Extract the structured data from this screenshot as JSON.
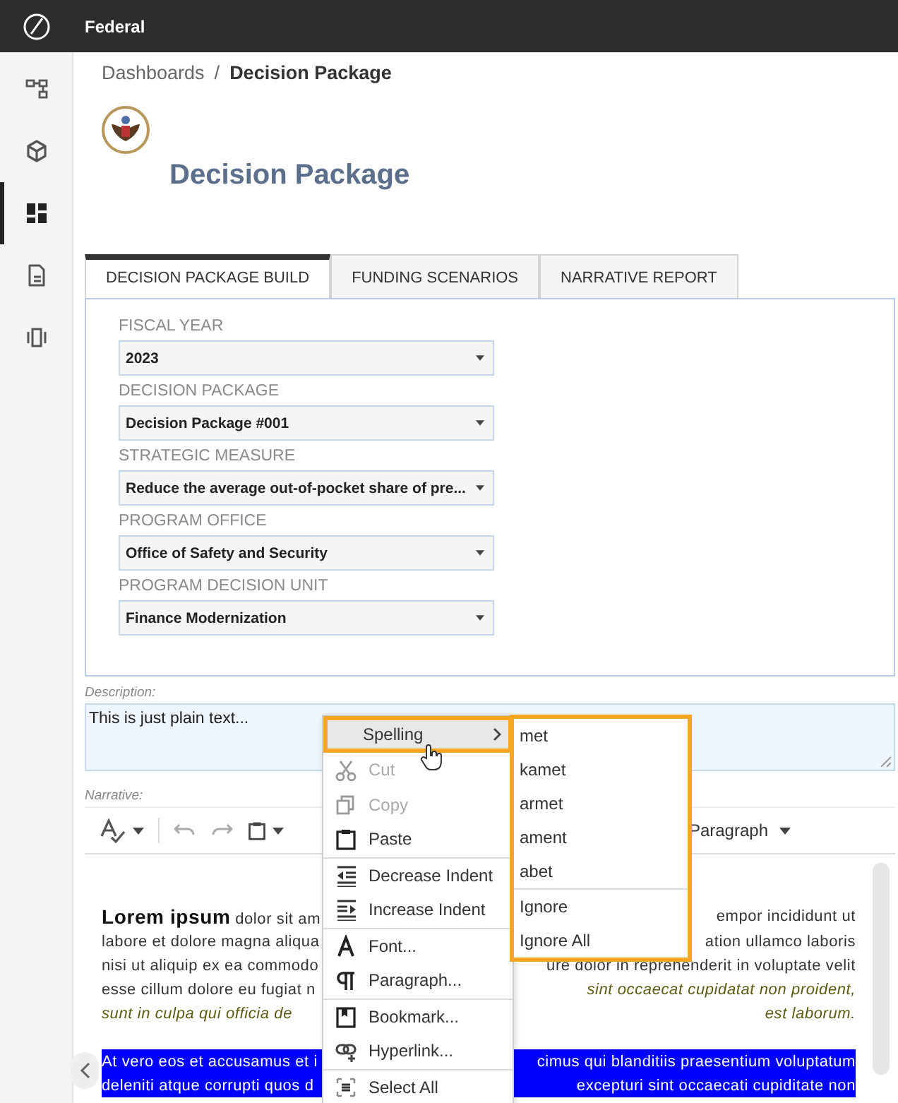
{
  "app_bar": {
    "title": "Federal"
  },
  "sidebar": {
    "items": [
      {
        "selected": false
      },
      {
        "selected": false
      },
      {
        "selected": true
      },
      {
        "selected": false
      },
      {
        "selected": false
      }
    ]
  },
  "breadcrumb": {
    "parent": "Dashboards",
    "separator": "/",
    "current": "Decision Package"
  },
  "page_title": "Decision Package",
  "tabs": [
    {
      "label": "DECISION PACKAGE BUILD",
      "selected": true
    },
    {
      "label": "FUNDING SCENARIOS",
      "selected": false
    },
    {
      "label": "NARRATIVE REPORT",
      "selected": false
    }
  ],
  "fields": [
    {
      "label": "FISCAL YEAR",
      "value": "2023"
    },
    {
      "label": "DECISION PACKAGE",
      "value": "Decision Package #001"
    },
    {
      "label": "STRATEGIC MEASURE",
      "value": "Reduce the average out-of-pocket share of pre..."
    },
    {
      "label": "PROGRAM OFFICE",
      "value": "Office of Safety and Security"
    },
    {
      "label": "PROGRAM DECISION UNIT",
      "value": "Finance Modernization"
    }
  ],
  "description": {
    "label": "Description:",
    "value": "This is just plain text..."
  },
  "narrative": {
    "label": "Narrative:",
    "format": "Paragraph",
    "paragraphs": [
      {
        "selected": false,
        "lines": [
          {
            "left": {
              "text": "**Lorem ipsum** dolor sit am",
              "italic": false
            },
            "right": {
              "text": "empor incididunt ut",
              "italic": false
            }
          },
          {
            "left": {
              "text": "labore et dolore magna aliqua",
              "italic": false
            },
            "right": {
              "text": "ation ullamco laboris",
              "italic": false
            }
          },
          {
            "left": {
              "text": "nisi ut aliquip ex ea commodo",
              "italic": false
            },
            "right": {
              "text": "ure dolor in reprehenderit in voluptate velit",
              "italic": false
            }
          },
          {
            "left": {
              "text": "esse cillum dolore eu fugiat n",
              "italic": false
            },
            "right": {
              "text": "sint occaecat cupidatat non proident,",
              "italic": true
            }
          },
          {
            "left": {
              "text": "sunt in culpa qui officia de",
              "italic": true
            },
            "right": {
              "text": "est laborum.",
              "italic": true
            }
          }
        ]
      },
      {
        "selected": true,
        "lines": [
          {
            "left": {
              "text": "At vero eos et accusamus et i",
              "italic": false
            },
            "right": {
              "text": "cimus qui blanditiis praesentium voluptatum",
              "italic": false
            }
          },
          {
            "left": {
              "text": "deleniti atque corrupti quos d",
              "italic": false
            },
            "right": {
              "text": "excepturi sint occaecati cupiditate non",
              "italic": false
            }
          }
        ]
      }
    ]
  },
  "context_menu": {
    "groups": [
      [
        {
          "label": "Spelling",
          "kind": "submenu",
          "selected": true,
          "disabled": false
        },
        {
          "label": "Cut",
          "kind": "command",
          "selected": false,
          "disabled": true
        },
        {
          "label": "Copy",
          "kind": "command",
          "selected": false,
          "disabled": true
        },
        {
          "label": "Paste",
          "kind": "command",
          "selected": false,
          "disabled": false
        }
      ],
      [
        {
          "label": "Decrease Indent",
          "kind": "command",
          "selected": false,
          "disabled": false
        },
        {
          "label": "Increase Indent",
          "kind": "command",
          "selected": false,
          "disabled": false
        }
      ],
      [
        {
          "label": "Font...",
          "kind": "command",
          "selected": false,
          "disabled": false
        },
        {
          "label": "Paragraph...",
          "kind": "command",
          "selected": false,
          "disabled": false
        }
      ],
      [
        {
          "label": "Bookmark...",
          "kind": "command",
          "selected": false,
          "disabled": false
        },
        {
          "label": "Hyperlink...",
          "kind": "command",
          "selected": false,
          "disabled": false
        }
      ],
      [
        {
          "label": "Select All",
          "kind": "command",
          "selected": false,
          "disabled": false
        }
      ]
    ]
  },
  "spelling_submenu": {
    "groups": [
      [
        "met",
        "kamet",
        "armet",
        "ament",
        "abet"
      ],
      [
        "Ignore",
        "Ignore All"
      ]
    ]
  }
}
